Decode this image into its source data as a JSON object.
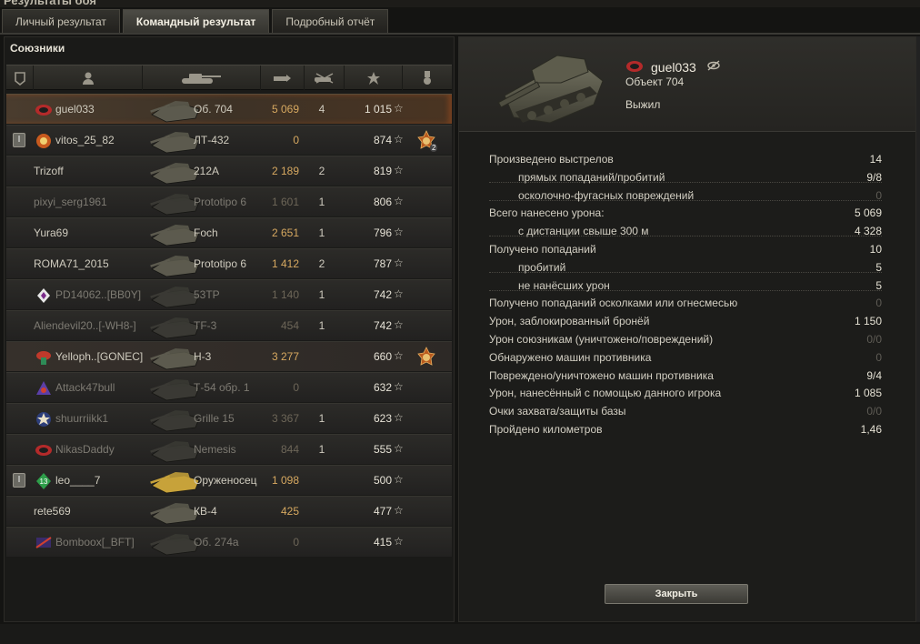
{
  "window": {
    "title": "Результаты боя"
  },
  "tabs": [
    {
      "label": "Личный результат",
      "active": false
    },
    {
      "label": "Командный результат",
      "active": true
    },
    {
      "label": "Подробный отчёт",
      "active": false
    }
  ],
  "left": {
    "title": "Союзники",
    "columns": [
      "squad-icon",
      "player-icon",
      "tank-icon",
      "damage-icon",
      "kills-icon",
      "xp-star-icon",
      "medal-icon"
    ],
    "rows": [
      {
        "player": "guel033",
        "vehicle": "Об. 704",
        "damage": "5 069",
        "kills": "4",
        "xp": "1 015",
        "self": true,
        "clan": "red-clan",
        "star": "☆"
      },
      {
        "player": "vitos_25_82",
        "vehicle": "ЛТ-432",
        "damage": "0",
        "kills": "",
        "xp": "874",
        "squad": true,
        "clan": "orange-clan",
        "medal": true,
        "medal_count": "2",
        "star": "☆"
      },
      {
        "player": "Trizoff",
        "vehicle": "212А",
        "damage": "2 189",
        "kills": "2",
        "xp": "819",
        "star": "☆"
      },
      {
        "player": "pixyi_serg1961",
        "vehicle": "Prototipo 6",
        "damage": "1 601",
        "kills": "1",
        "xp": "806",
        "dead": true,
        "star": "☆"
      },
      {
        "player": "Yura69",
        "vehicle": "Foch",
        "damage": "2 651",
        "kills": "1",
        "xp": "796",
        "star": "☆"
      },
      {
        "player": "ROMA71_2015",
        "vehicle": "Prototipo 6",
        "damage": "1 412",
        "kills": "2",
        "xp": "787",
        "star": "☆"
      },
      {
        "player": "PD14062..[BB0Y]",
        "vehicle": "53TP",
        "damage": "1 140",
        "kills": "1",
        "xp": "742",
        "dead": true,
        "clan": "white-clan",
        "star": "☆"
      },
      {
        "player": "Aliendevil20..[-WH8-]",
        "vehicle": "TF-3",
        "damage": "454",
        "kills": "1",
        "xp": "742",
        "dead": true,
        "star": "☆"
      },
      {
        "player": "Yelloph..[GONEC]",
        "vehicle": "Н-3",
        "damage": "3 277",
        "kills": "",
        "xp": "660",
        "squad_tint": true,
        "clan": "mushroom-clan",
        "medal": true,
        "star": "☆"
      },
      {
        "player": "Attack47bull",
        "vehicle": "Т-54 обр. 1",
        "damage": "0",
        "kills": "",
        "xp": "632",
        "dead": true,
        "clan": "purple-clan",
        "star": "☆"
      },
      {
        "player": "shuurriikk1",
        "vehicle": "Grille 15",
        "damage": "3 367",
        "kills": "1",
        "xp": "623",
        "dead": true,
        "clan": "blue-clan",
        "star": "☆"
      },
      {
        "player": "NikasDaddy",
        "vehicle": "Nemesis",
        "damage": "844",
        "kills": "1",
        "xp": "555",
        "dead": true,
        "clan": "red-clan",
        "star": "☆"
      },
      {
        "player": "leo____7",
        "vehicle": "Оруженосец",
        "damage": "1 098",
        "kills": "",
        "xp": "500",
        "squad": true,
        "clan": "green-clan",
        "gold": true,
        "star": "☆"
      },
      {
        "player": "rete569",
        "vehicle": "КВ-4",
        "damage": "425",
        "kills": "",
        "xp": "477",
        "star": "☆"
      },
      {
        "player": "Bomboox[_BFT]",
        "vehicle": "Об. 274а",
        "damage": "0",
        "kills": "",
        "xp": "415",
        "dead": true,
        "clan": "flag-clan",
        "star": "☆"
      }
    ]
  },
  "right": {
    "player": "guel033",
    "vehicle": "Объект 704",
    "status": "Выжил",
    "stats": [
      {
        "label": "Произведено выстрелов",
        "value": "14",
        "sub": false,
        "zero": false
      },
      {
        "label": "прямых попаданий/пробитий",
        "value": "9/8",
        "sub": true,
        "zero": false
      },
      {
        "label": "осколочно-фугасных повреждений",
        "value": "0",
        "sub": true,
        "zero": true
      },
      {
        "label": "Всего нанесено урона:",
        "value": "5 069",
        "sub": false,
        "zero": false
      },
      {
        "label": "с дистанции свыше 300 м",
        "value": "4 328",
        "sub": true,
        "zero": false
      },
      {
        "label": "Получено попаданий",
        "value": "10",
        "sub": false,
        "zero": false
      },
      {
        "label": "пробитий",
        "value": "5",
        "sub": true,
        "zero": false
      },
      {
        "label": "не нанёсших урон",
        "value": "5",
        "sub": true,
        "zero": false
      },
      {
        "label": "Получено попаданий осколками или огнесмесью",
        "value": "0",
        "sub": false,
        "zero": true
      },
      {
        "label": "Урон, заблокированный бронёй",
        "value": "1 150",
        "sub": false,
        "zero": false
      },
      {
        "label": "Урон союзникам (уничтожено/повреждений)",
        "value": "0/0",
        "sub": false,
        "zero": true
      },
      {
        "label": "Обнаружено машин противника",
        "value": "0",
        "sub": false,
        "zero": true
      },
      {
        "label": "Повреждено/уничтожено машин противника",
        "value": "9/4",
        "sub": false,
        "zero": false
      },
      {
        "label": "Урон, нанесённый с помощью данного игрока",
        "value": "1 085",
        "sub": false,
        "zero": false
      },
      {
        "label": "Очки захвата/защиты базы",
        "value": "0/0",
        "sub": false,
        "zero": true
      },
      {
        "label": "Пройдено километров",
        "value": "1,46",
        "sub": false,
        "zero": false
      }
    ],
    "close_label": "Закрыть"
  },
  "colors": {
    "damage": "#d6a860",
    "self_row": "#4a3c2e",
    "gold_tank": "#c7a23a"
  }
}
